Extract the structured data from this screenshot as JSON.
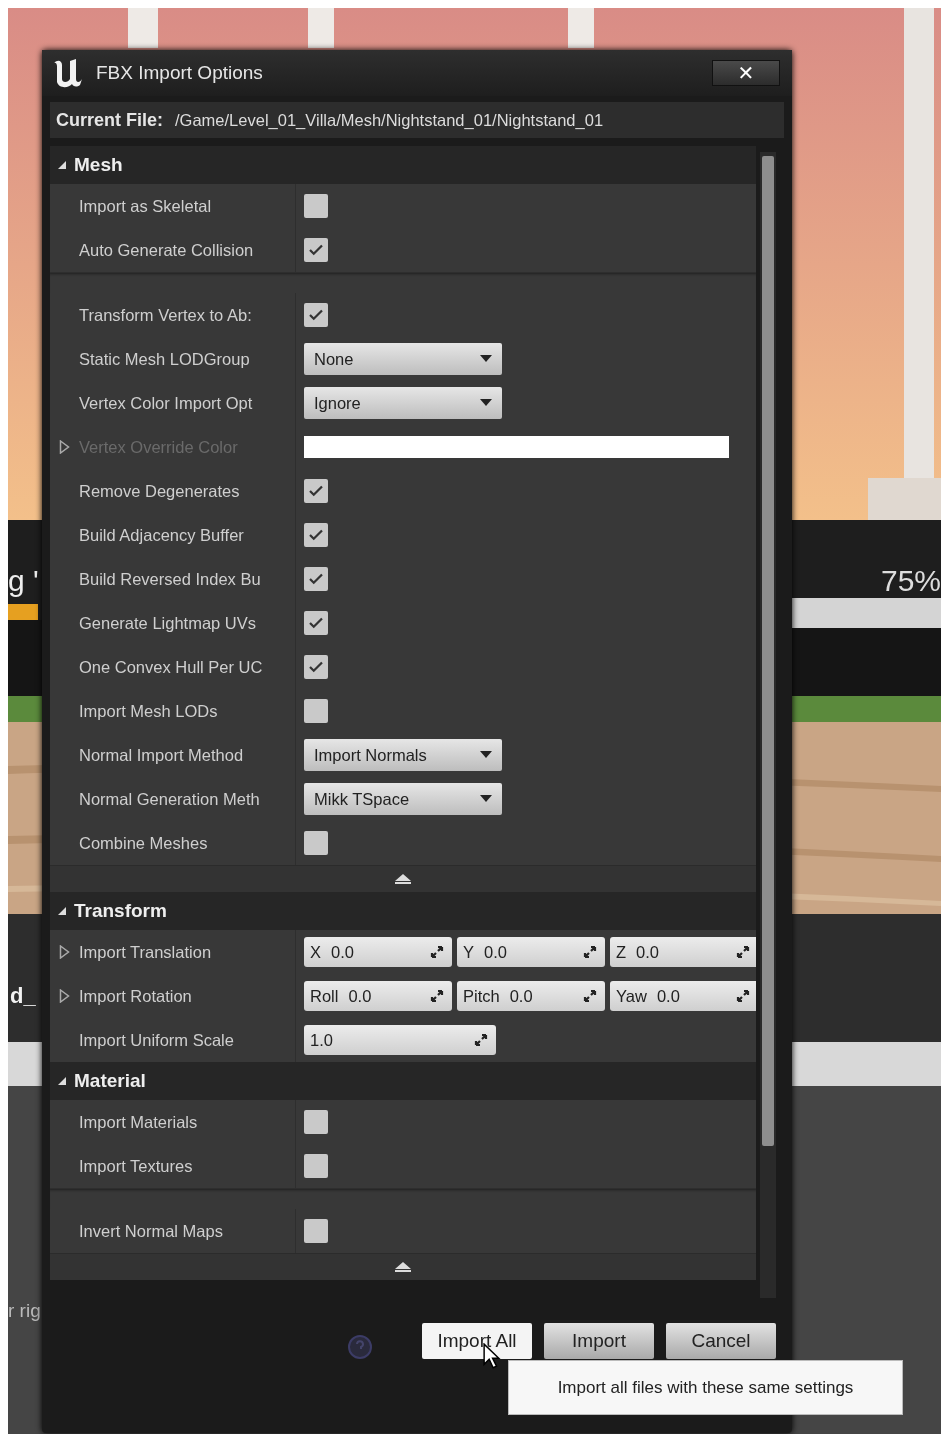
{
  "window": {
    "title": "FBX Import Options",
    "close": "✕"
  },
  "current_file": {
    "label": "Current File:",
    "path": "/Game/Level_01_Villa/Mesh/Nightstand_01/Nightstand_01"
  },
  "sections": [
    {
      "title": "Mesh",
      "expanded": true,
      "collapse_bar": true,
      "groups": [
        [
          {
            "kind": "checkbox",
            "label": "Import as Skeletal",
            "checked": false,
            "expandable": false,
            "disabled": false
          },
          {
            "kind": "checkbox",
            "label": "Auto Generate Collision",
            "checked": true,
            "expandable": false,
            "disabled": false
          }
        ],
        [
          {
            "kind": "checkbox",
            "label": "Transform Vertex to Ab:",
            "checked": true,
            "expandable": false,
            "disabled": false
          },
          {
            "kind": "dropdown",
            "label": "Static Mesh LODGroup",
            "value": "None",
            "expandable": false,
            "disabled": false
          },
          {
            "kind": "dropdown",
            "label": "Vertex Color Import Opt",
            "value": "Ignore",
            "expandable": false,
            "disabled": false
          },
          {
            "kind": "color",
            "label": "Vertex Override Color",
            "expandable": true,
            "disabled": true
          },
          {
            "kind": "checkbox",
            "label": "Remove Degenerates",
            "checked": true,
            "expandable": false,
            "disabled": false
          },
          {
            "kind": "checkbox",
            "label": "Build Adjacency Buffer",
            "checked": true,
            "expandable": false,
            "disabled": false
          },
          {
            "kind": "checkbox",
            "label": "Build Reversed Index Bu",
            "checked": true,
            "expandable": false,
            "disabled": false
          },
          {
            "kind": "checkbox",
            "label": "Generate Lightmap UVs",
            "checked": true,
            "expandable": false,
            "disabled": false
          },
          {
            "kind": "checkbox",
            "label": "One Convex Hull Per UC",
            "checked": true,
            "expandable": false,
            "disabled": false
          },
          {
            "kind": "checkbox",
            "label": "Import Mesh LODs",
            "checked": false,
            "expandable": false,
            "disabled": false
          },
          {
            "kind": "dropdown",
            "label": "Normal Import Method",
            "value": "Import Normals",
            "expandable": false,
            "disabled": false
          },
          {
            "kind": "dropdown",
            "label": "Normal Generation Meth",
            "value": "Mikk TSpace",
            "expandable": false,
            "disabled": false
          },
          {
            "kind": "checkbox",
            "label": "Combine Meshes",
            "checked": false,
            "expandable": false,
            "disabled": false
          }
        ]
      ]
    },
    {
      "title": "Transform",
      "expanded": true,
      "collapse_bar": false,
      "groups": [
        [
          {
            "kind": "vector",
            "label": "Import Translation",
            "expandable": true,
            "disabled": false,
            "fields": [
              {
                "axis": "X",
                "value": "0.0"
              },
              {
                "axis": "Y",
                "value": "0.0"
              },
              {
                "axis": "Z",
                "value": "0.0"
              }
            ]
          },
          {
            "kind": "vector",
            "label": "Import Rotation",
            "expandable": true,
            "disabled": false,
            "fields": [
              {
                "axis": "Roll",
                "value": "0.0"
              },
              {
                "axis": "Pitch",
                "value": "0.0"
              },
              {
                "axis": "Yaw",
                "value": "0.0"
              }
            ]
          },
          {
            "kind": "number",
            "label": "Import Uniform Scale",
            "value": "1.0",
            "expandable": false,
            "disabled": false
          }
        ]
      ]
    },
    {
      "title": "Material",
      "expanded": true,
      "collapse_bar": true,
      "groups": [
        [
          {
            "kind": "checkbox",
            "label": "Import Materials",
            "checked": false,
            "expandable": false,
            "disabled": false
          },
          {
            "kind": "checkbox",
            "label": "Import Textures",
            "checked": false,
            "expandable": false,
            "disabled": false
          }
        ],
        [
          {
            "kind": "checkbox",
            "label": "Invert Normal Maps",
            "checked": false,
            "expandable": false,
            "disabled": false
          }
        ]
      ]
    }
  ],
  "footer": {
    "buttons": [
      {
        "label": "Import All",
        "hovered": true
      },
      {
        "label": "Import",
        "hovered": false
      },
      {
        "label": "Cancel",
        "hovered": false
      }
    ],
    "tooltip": "Import all files with these same settings"
  },
  "background_texts": [
    {
      "kind": "left",
      "text": "g '"
    },
    {
      "kind": "right",
      "text": "75%"
    },
    {
      "kind": "left-mid",
      "text": "d_"
    },
    {
      "kind": "left-low",
      "text": "r rig"
    }
  ]
}
